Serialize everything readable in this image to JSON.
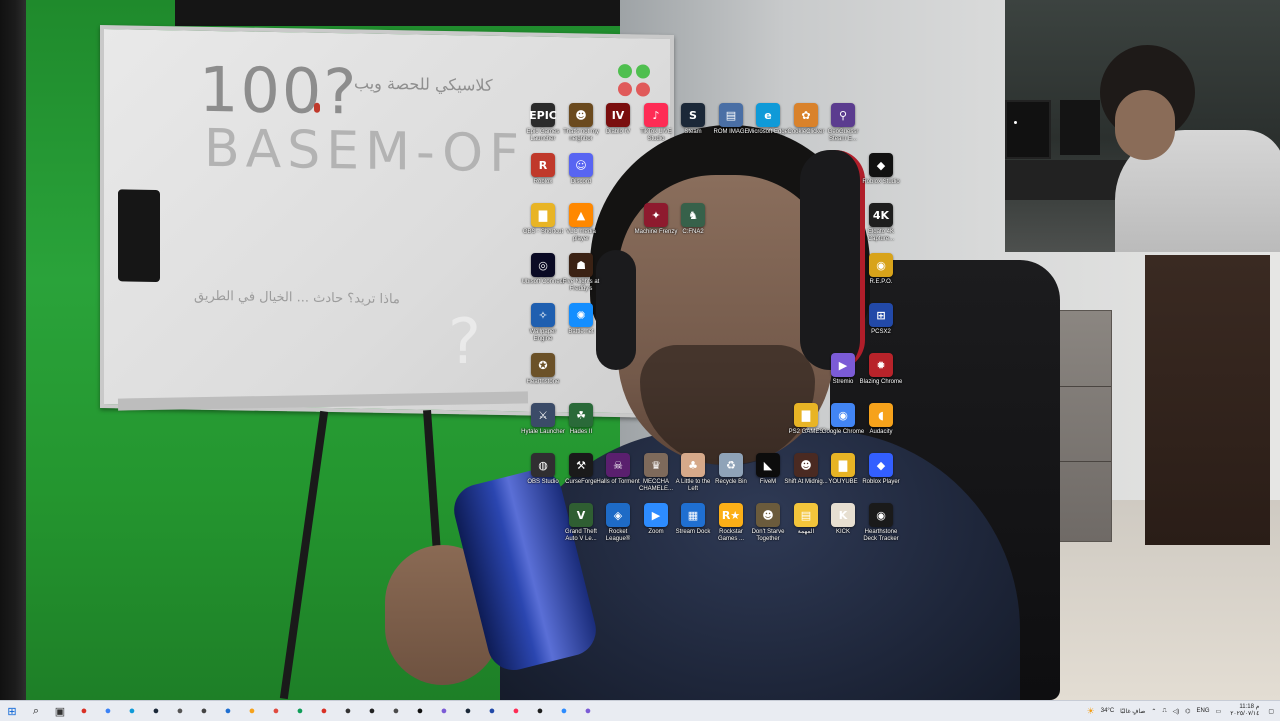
{
  "whiteboard": {
    "line1": "100?",
    "line2": "BASEM-OF",
    "arabic1": "كلاسيكي للحصة ويب",
    "arabic2": "ماذا تريد؟ حادث ... الخيال في الطريق"
  },
  "desktop_icons": [
    {
      "id": "epic-games",
      "label": "Epic Games Launcher",
      "glyph": "EPIC",
      "color": "#2b2b2b"
    },
    {
      "id": "thats-not-my-neighbor",
      "label": "That's not my neighbor",
      "glyph": "☻",
      "color": "#6b4a1e"
    },
    {
      "id": "diablo-iv",
      "label": "Diablo IV",
      "glyph": "IV",
      "color": "#7a0e0e"
    },
    {
      "id": "tiktok-live-studio",
      "label": "TikTok LIVE Studio",
      "glyph": "♪",
      "color": "#fe2c55"
    },
    {
      "id": "steam",
      "label": "Steam",
      "glyph": "S",
      "color": "#1b2838"
    },
    {
      "id": "rom-image",
      "label": "ROM IMAGE",
      "glyph": "▤",
      "color": "#4a6fa5"
    },
    {
      "id": "microsoft-edge",
      "label": "Microsoft Edge",
      "glyph": "e",
      "color": "#0f9ad8"
    },
    {
      "id": "cookie-clicker",
      "label": "CookieClicker",
      "glyph": "✿",
      "color": "#d9822b"
    },
    {
      "id": "geoguessr-steam",
      "label": "GeoGuessr Steam E...",
      "glyph": "⚲",
      "color": "#5b3c8f"
    },
    {
      "id": "roblox-studio",
      "label": "Roblox Studio",
      "glyph": "◆",
      "color": "#111111"
    },
    {
      "id": "roblox",
      "label": "Roblox",
      "glyph": "R",
      "color": "#c0392b"
    },
    {
      "id": "discord",
      "label": "Discord",
      "glyph": "☺",
      "color": "#5865f2"
    },
    {
      "id": "obs-shortcut",
      "label": "OBS - Shortcut",
      "glyph": "▇",
      "color": "#e8b425"
    },
    {
      "id": "vlc",
      "label": "VLC media player",
      "glyph": "▲",
      "color": "#ff8800"
    },
    {
      "id": "machine-frenzy",
      "label": "Machine Frenzy",
      "glyph": "✦",
      "color": "#8e1a2e"
    },
    {
      "id": "unnamed-1",
      "label": "C:FNA2",
      "glyph": "♞",
      "color": "#37614a"
    },
    {
      "id": "4k-capture",
      "label": "Elgato 4K Capture...",
      "glyph": "4K",
      "color": "#1e1e1e"
    },
    {
      "id": "ubisoft-connect",
      "label": "Ubisoft Connect",
      "glyph": "◎",
      "color": "#0a0a24"
    },
    {
      "id": "fnaf",
      "label": "Five Nights at Freddy's",
      "glyph": "☗",
      "color": "#3b2214"
    },
    {
      "id": "repo",
      "label": "R.E.P.O.",
      "glyph": "◉",
      "color": "#d8a31a"
    },
    {
      "id": "wallpaper-engine",
      "label": "Wallpaper Engine",
      "glyph": "✧",
      "color": "#1f5fb0"
    },
    {
      "id": "battlenet",
      "label": "Battle.net",
      "glyph": "✺",
      "color": "#148eff"
    },
    {
      "id": "pcsx2",
      "label": "PCSX2",
      "glyph": "⊞",
      "color": "#2249a8"
    },
    {
      "id": "hearthstone",
      "label": "Hearthstone",
      "glyph": "✪",
      "color": "#6b5128"
    },
    {
      "id": "stremio",
      "label": "Stremio",
      "glyph": "▶",
      "color": "#7b5bd6"
    },
    {
      "id": "blazing-chrome",
      "label": "Blazing Chrome",
      "glyph": "✹",
      "color": "#b8232a"
    },
    {
      "id": "hytale-launcher",
      "label": "Hytale Launcher",
      "glyph": "⚔",
      "color": "#3b4b68"
    },
    {
      "id": "hades-ii",
      "label": "Hades II",
      "glyph": "☘",
      "color": "#2a6a39"
    },
    {
      "id": "ps2-games",
      "label": "PS2 GAMES",
      "glyph": "▇",
      "color": "#e8b425"
    },
    {
      "id": "google-chrome",
      "label": "Google Chrome",
      "glyph": "◉",
      "color": "#4285f4"
    },
    {
      "id": "audacity",
      "label": "Audacity",
      "glyph": "◖",
      "color": "#f6a21b"
    },
    {
      "id": "obs-studio",
      "label": "OBS Studio",
      "glyph": "◍",
      "color": "#302e31"
    },
    {
      "id": "curseforge",
      "label": "CurseForge",
      "glyph": "⚒",
      "color": "#1a1a1a"
    },
    {
      "id": "halls-of-torment",
      "label": "Halls of Torment",
      "glyph": "☠",
      "color": "#5a1f6e"
    },
    {
      "id": "meccha-chameleon",
      "label": "MECCHA CHAMELE...",
      "glyph": "♛",
      "color": "#7e6a5b"
    },
    {
      "id": "a-little-to-the-left",
      "label": "A Little to the Left",
      "glyph": "♣",
      "color": "#d6a98a"
    },
    {
      "id": "recycle-bin",
      "label": "Recycle Bin",
      "glyph": "♻",
      "color": "#8fa3b8"
    },
    {
      "id": "fivem",
      "label": "FiveM",
      "glyph": "◣",
      "color": "#0c0c0c"
    },
    {
      "id": "shift-at-midnight",
      "label": "Shift At Midnig...",
      "glyph": "☻",
      "color": "#4a2a22"
    },
    {
      "id": "youyube",
      "label": "YOUYUBE",
      "glyph": "▇",
      "color": "#e8b425"
    },
    {
      "id": "roblox-player",
      "label": "Roblox Player",
      "glyph": "◆",
      "color": "#335fff"
    },
    {
      "id": "gta-v",
      "label": "Grand Theft Auto V Le...",
      "glyph": "V",
      "color": "#2f5e32"
    },
    {
      "id": "rocket-league",
      "label": "Rocket League®",
      "glyph": "◈",
      "color": "#1e6bc6"
    },
    {
      "id": "zoom",
      "label": "Zoom",
      "glyph": "▶",
      "color": "#2d8cff"
    },
    {
      "id": "stream-dock",
      "label": "Stream Dock",
      "glyph": "▦",
      "color": "#1f6fd1"
    },
    {
      "id": "rockstar-games",
      "label": "Rockstar Games ...",
      "glyph": "R★",
      "color": "#fcaf17"
    },
    {
      "id": "dont-starve-together",
      "label": "Don't Starve Together",
      "glyph": "☻",
      "color": "#6b5b3c"
    },
    {
      "id": "arabic-doc",
      "label": "المهمة",
      "glyph": "▤",
      "color": "#f3c53b"
    },
    {
      "id": "kick",
      "label": "KICK",
      "glyph": "K",
      "color": "#e7dfd1"
    },
    {
      "id": "hearthstone-deck-tracker",
      "label": "Hearthstone Deck Tracker",
      "glyph": "◉",
      "color": "#1a1a1a"
    }
  ],
  "taskbar": {
    "apps": [
      {
        "id": "start",
        "glyph": "⊞",
        "color": "#0a64d6"
      },
      {
        "id": "search",
        "glyph": "⌕",
        "color": "#222"
      },
      {
        "id": "task-view",
        "glyph": "▣",
        "color": "#333"
      },
      {
        "id": "app-1",
        "glyph": "●",
        "color": "#d93025"
      },
      {
        "id": "app-2",
        "glyph": "●",
        "color": "#3b82f6"
      },
      {
        "id": "app-3",
        "glyph": "●",
        "color": "#0f9ad8"
      },
      {
        "id": "app-4",
        "glyph": "●",
        "color": "#1b2838"
      },
      {
        "id": "app-5",
        "glyph": "●",
        "color": "#555"
      },
      {
        "id": "app-6",
        "glyph": "●",
        "color": "#444"
      },
      {
        "id": "app-7",
        "glyph": "●",
        "color": "#1f6fd1"
      },
      {
        "id": "app-8",
        "glyph": "●",
        "color": "#f6a21b"
      },
      {
        "id": "app-9",
        "glyph": "●",
        "color": "#e04a3f"
      },
      {
        "id": "app-10",
        "glyph": "●",
        "color": "#0f9d58"
      },
      {
        "id": "app-11",
        "glyph": "●",
        "color": "#d93025"
      },
      {
        "id": "app-12",
        "glyph": "●",
        "color": "#333"
      },
      {
        "id": "app-13",
        "glyph": "●",
        "color": "#222"
      },
      {
        "id": "app-14",
        "glyph": "●",
        "color": "#4b4b4b"
      },
      {
        "id": "app-15",
        "glyph": "●",
        "color": "#111"
      },
      {
        "id": "app-16",
        "glyph": "●",
        "color": "#7b5bd6"
      },
      {
        "id": "app-17",
        "glyph": "●",
        "color": "#1b2838"
      },
      {
        "id": "app-18",
        "glyph": "●",
        "color": "#2249a8"
      },
      {
        "id": "app-19",
        "glyph": "●",
        "color": "#fe2c55"
      },
      {
        "id": "app-20",
        "glyph": "●",
        "color": "#1e1e1e"
      },
      {
        "id": "app-21",
        "glyph": "●",
        "color": "#2d8cff"
      },
      {
        "id": "app-22",
        "glyph": "●",
        "color": "#7b5bd6"
      }
    ],
    "weather": "34°C",
    "weather_desc": "صافٍ غالبًا",
    "language": "ENG",
    "time": "11:18 م",
    "date": "٢٠٢٥/٠٧/١٤"
  }
}
